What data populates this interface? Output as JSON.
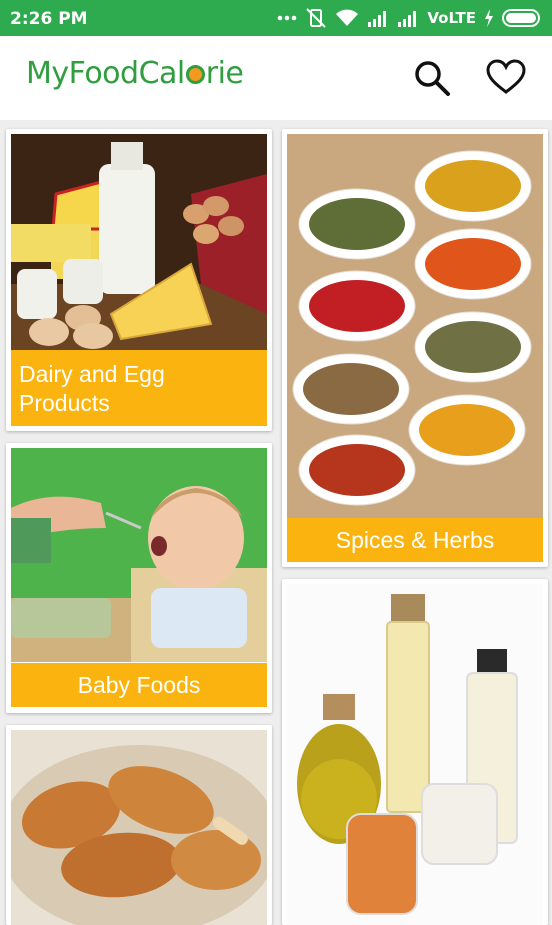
{
  "status_bar": {
    "time": "2:26 PM",
    "network_label": "VoLTE",
    "icons": [
      "more-dots-icon",
      "vibrate-off-icon",
      "wifi-icon",
      "signal-icon",
      "signal-icon",
      "charging-icon",
      "battery-icon"
    ]
  },
  "app_bar": {
    "title_part1": "MyFoodCal",
    "title_part2": "rie",
    "brand_color": "#2e9e3f",
    "accent_color": "#f39a1e"
  },
  "categories": [
    {
      "label": "Dairy and Egg Products"
    },
    {
      "label": "Spices & Herbs"
    },
    {
      "label": "Baby Foods"
    },
    {
      "label": ""
    },
    {
      "label": ""
    }
  ],
  "colors": {
    "status_bar": "#2eab4f",
    "label_bg": "#fbb40f",
    "card_bg": "#ffffff"
  }
}
